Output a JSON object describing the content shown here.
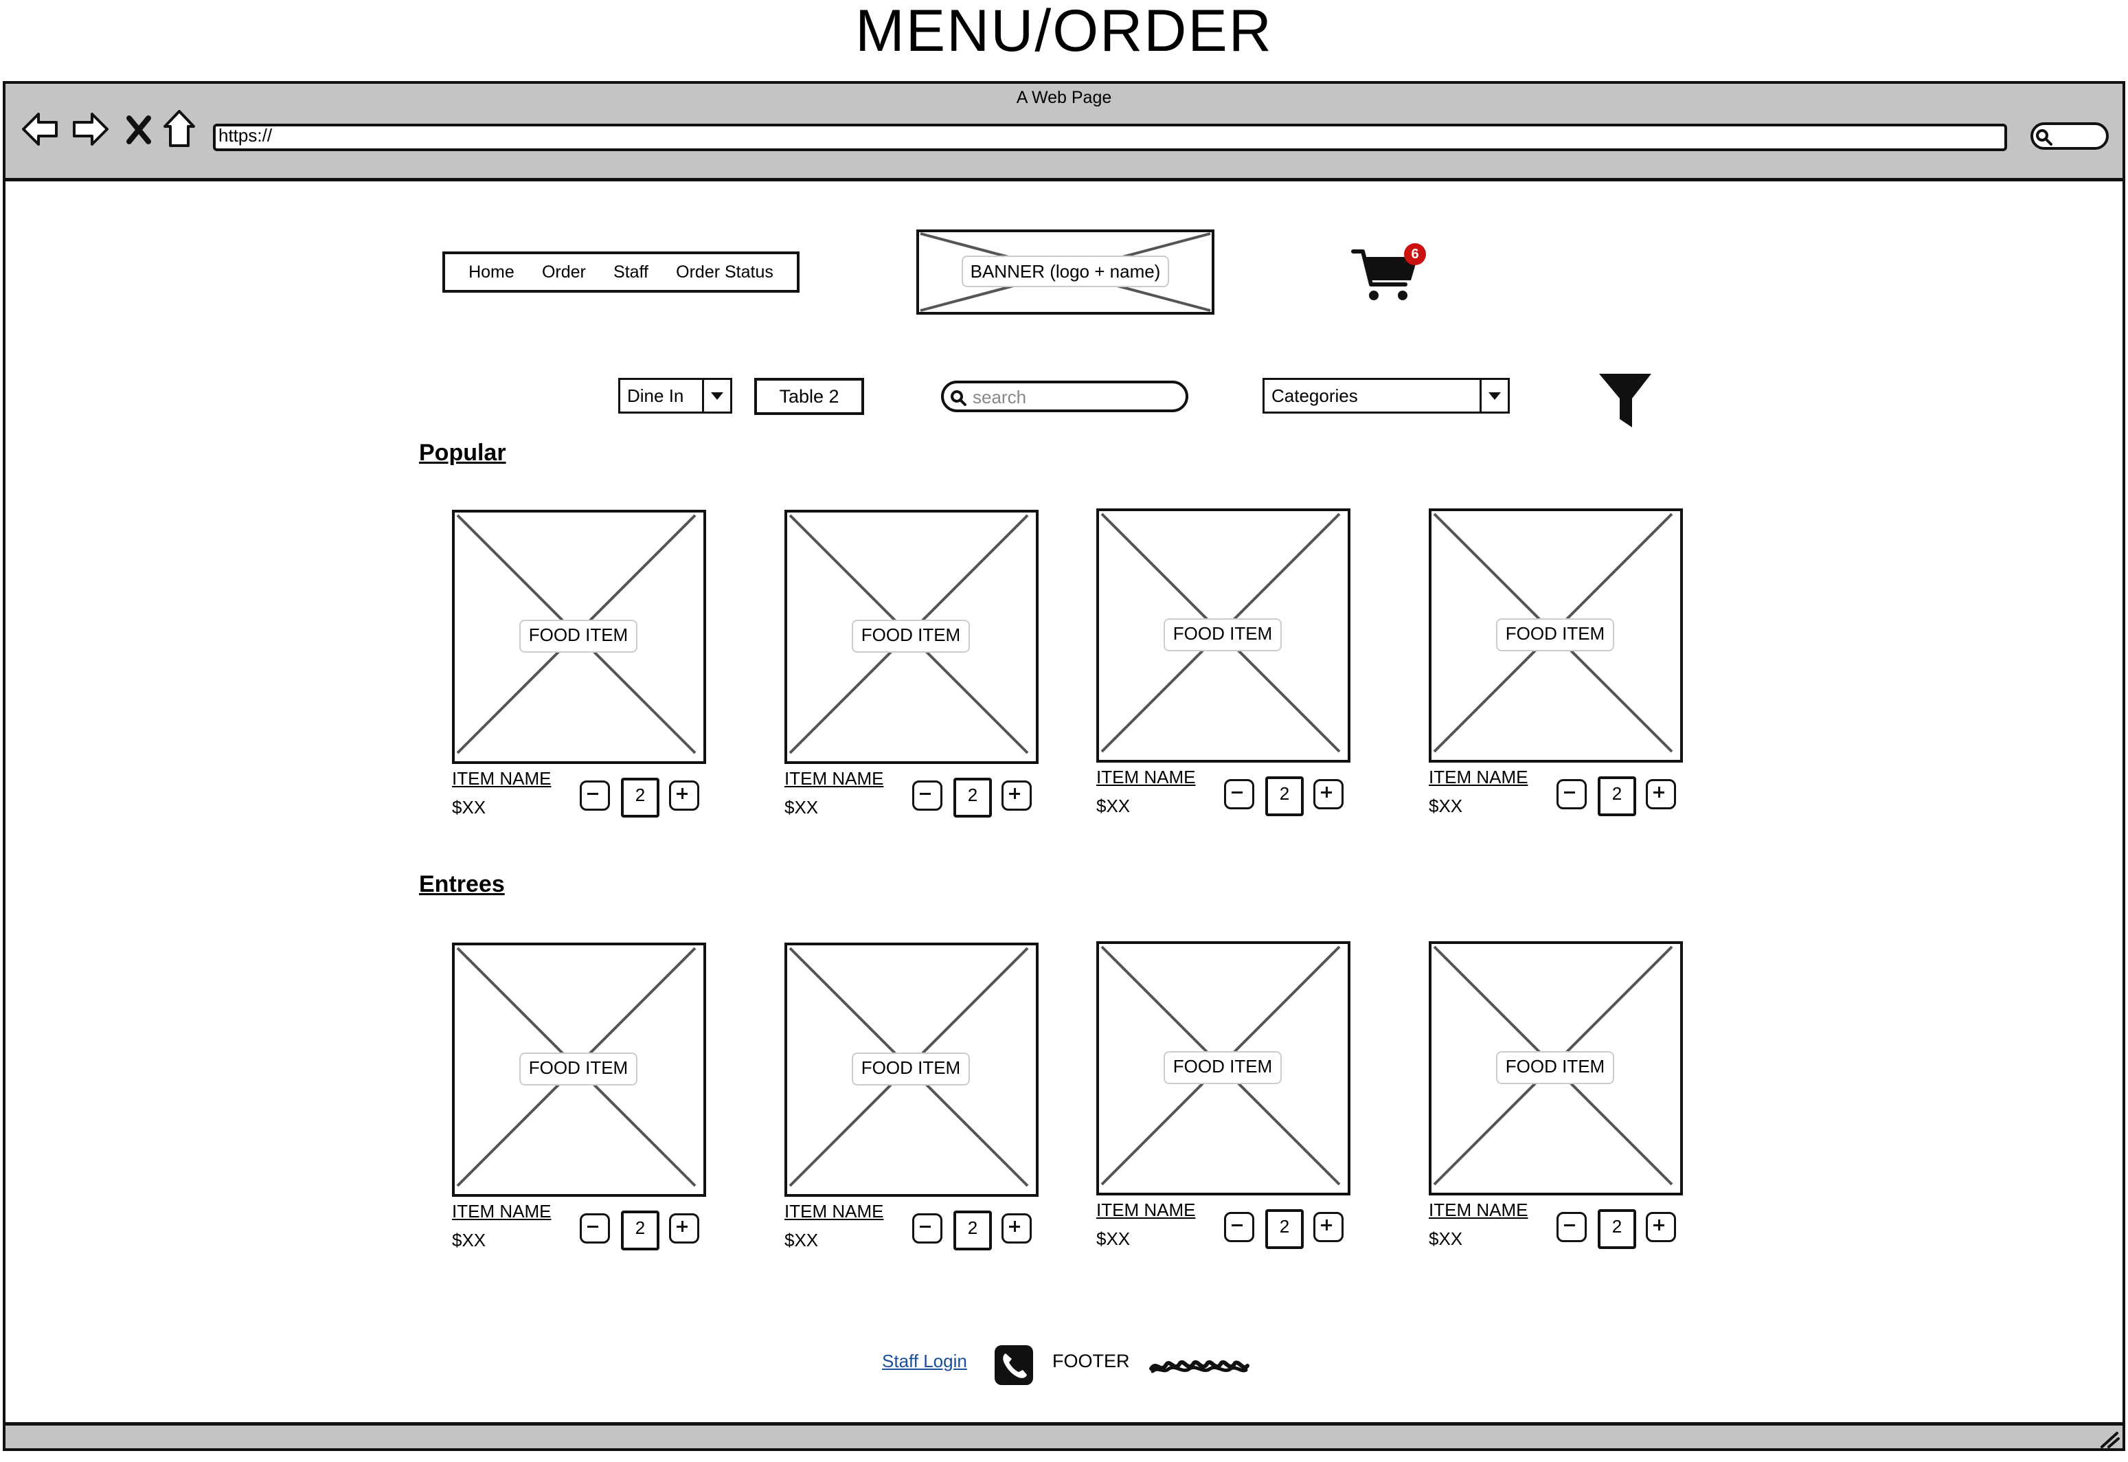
{
  "page": {
    "title": "MENU/ORDER"
  },
  "browser": {
    "window_title": "A Web Page",
    "url": "https://"
  },
  "nav": {
    "items": [
      "Home",
      "Order",
      "Staff",
      "Order Status"
    ]
  },
  "banner": {
    "label": "BANNER (logo + name)"
  },
  "cart": {
    "count": "6"
  },
  "controls": {
    "dine_option": "Dine In",
    "table": "Table 2",
    "search_placeholder": "search",
    "categories": "Categories"
  },
  "sections": [
    {
      "title": "Popular",
      "items": [
        {
          "image_label": "FOOD ITEM",
          "name": "ITEM NAME",
          "price": "$XX",
          "quantity": "2"
        },
        {
          "image_label": "FOOD ITEM",
          "name": "ITEM NAME",
          "price": "$XX",
          "quantity": "2"
        },
        {
          "image_label": "FOOD ITEM",
          "name": "ITEM NAME",
          "price": "$XX",
          "quantity": "2"
        },
        {
          "image_label": "FOOD ITEM",
          "name": "ITEM NAME",
          "price": "$XX",
          "quantity": "2"
        }
      ]
    },
    {
      "title": "Entrees",
      "items": [
        {
          "image_label": "FOOD ITEM",
          "name": "ITEM NAME",
          "price": "$XX",
          "quantity": "2"
        },
        {
          "image_label": "FOOD ITEM",
          "name": "ITEM NAME",
          "price": "$XX",
          "quantity": "2"
        },
        {
          "image_label": "FOOD ITEM",
          "name": "ITEM NAME",
          "price": "$XX",
          "quantity": "2"
        },
        {
          "image_label": "FOOD ITEM",
          "name": "ITEM NAME",
          "price": "$XX",
          "quantity": "2"
        }
      ]
    }
  ],
  "footer": {
    "staff_login": "Staff Login",
    "text": "FOOTER"
  },
  "colors": {
    "chrome": "#c4c4c4",
    "badge": "#cc1111",
    "link": "#1a4e9a"
  }
}
